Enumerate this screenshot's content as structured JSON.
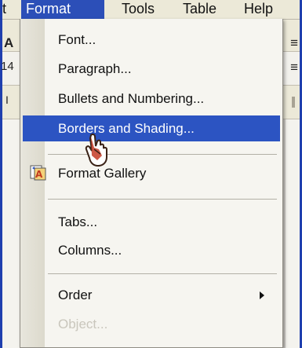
{
  "menubar": {
    "edge": "t",
    "items": [
      {
        "label": "Format",
        "active": true
      },
      {
        "label": "Tools"
      },
      {
        "label": "Table"
      },
      {
        "label": "Help"
      }
    ]
  },
  "toolbar": {
    "left_glyphs": [
      "A",
      "14",
      "I"
    ]
  },
  "format_menu": {
    "items": [
      {
        "label": "Font..."
      },
      {
        "label": "Paragraph..."
      },
      {
        "label": "Bullets and Numbering..."
      },
      {
        "label": "Borders and Shading...",
        "highlighted": true
      },
      {
        "label": "Format Gallery",
        "icon": "format-gallery-icon"
      },
      {
        "label": "Tabs..."
      },
      {
        "label": "Columns..."
      },
      {
        "label": "Order",
        "submenu": true
      },
      {
        "label": "Object...",
        "disabled": true
      }
    ]
  },
  "colors": {
    "menu_highlight": "#2c54c2",
    "menubar_active": "#2c4fb8",
    "window_frame": "#1f3fae",
    "disabled_text": "#c9c6bc"
  }
}
